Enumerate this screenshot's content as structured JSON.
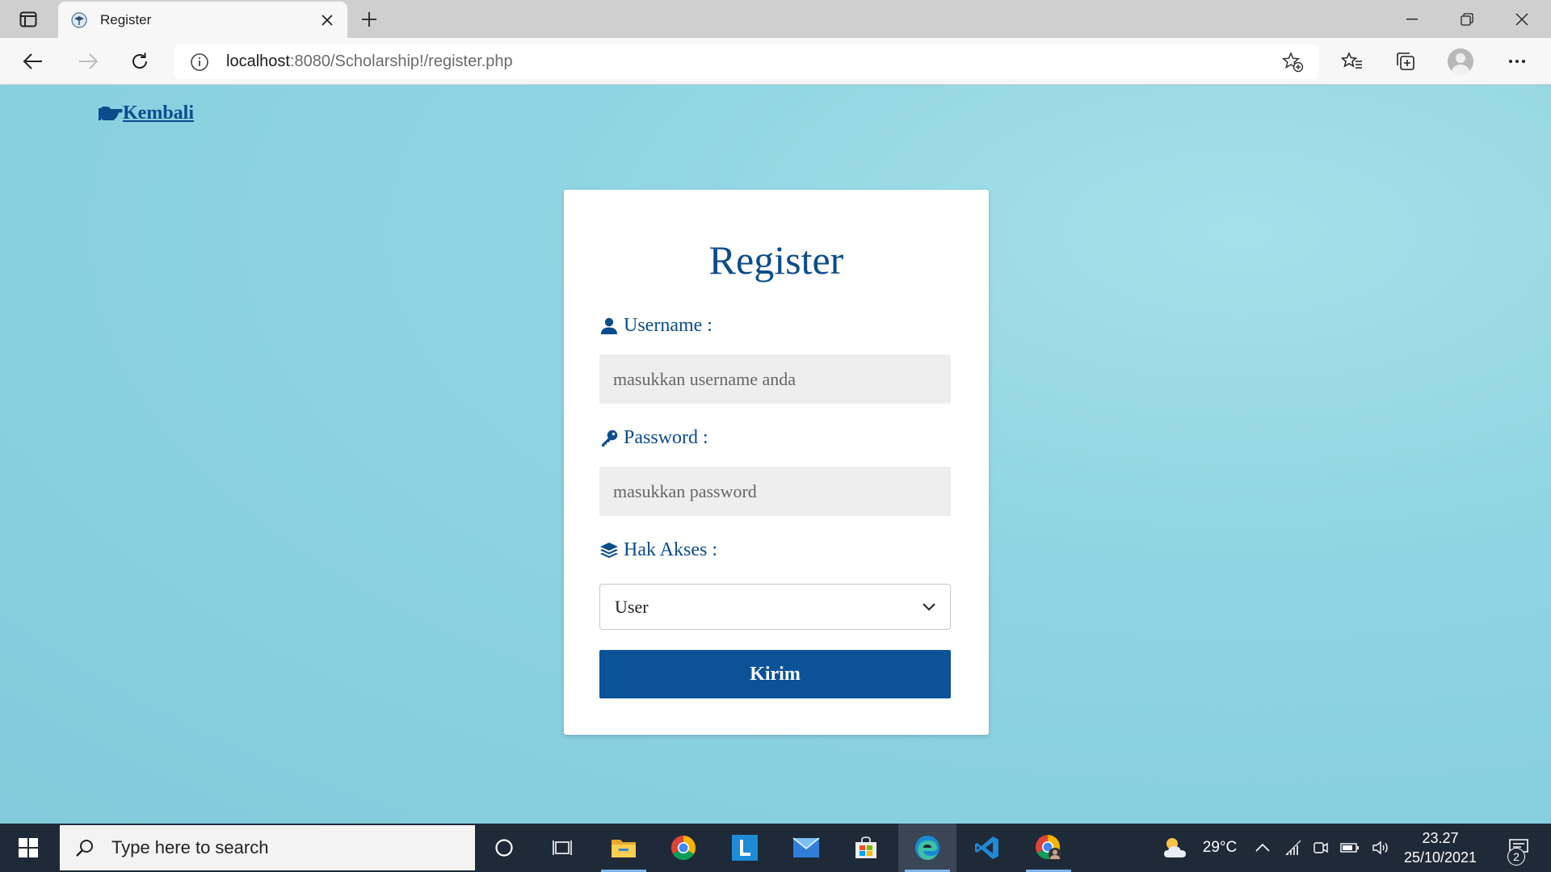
{
  "browser": {
    "tab_title": "Register",
    "url_host": "localhost",
    "url_path": ":8080/Scholarship!/register.php"
  },
  "page": {
    "back_label": "Kembali",
    "card_title": "Register",
    "username_label": "Username :",
    "username_placeholder": "masukkan username anda",
    "password_label": "Password :",
    "password_placeholder": "masukkan password",
    "access_label": "Hak Akses :",
    "access_selected": "User",
    "submit_label": "Kirim"
  },
  "taskbar": {
    "search_placeholder": "Type here to search",
    "temperature": "29°C",
    "time": "23.27",
    "date": "25/10/2021",
    "notification_count": "2"
  },
  "colors": {
    "accent": "#0b4c8c",
    "button": "#0b5299",
    "background": "#8ed4e0"
  },
  "icons": [
    "tab-actions-icon",
    "graduation-cap-icon",
    "close-icon",
    "plus-icon",
    "minimize-icon",
    "restore-icon",
    "back-arrow-icon",
    "forward-arrow-icon",
    "refresh-icon",
    "info-icon",
    "add-favorite-icon",
    "favorites-icon",
    "collections-icon",
    "profile-icon",
    "more-icon",
    "pointing-hand-icon",
    "user-icon",
    "key-icon",
    "layers-icon",
    "chevron-down-icon",
    "windows-icon",
    "search-icon",
    "cortana-icon",
    "task-view-icon",
    "file-explorer-icon",
    "chrome-icon",
    "lenovo-icon",
    "mail-icon",
    "store-icon",
    "edge-icon",
    "vscode-icon",
    "chrome-profile-icon",
    "weather-icon",
    "chevron-up-icon",
    "network-icon",
    "meet-icon",
    "battery-icon",
    "volume-icon",
    "notification-icon"
  ]
}
